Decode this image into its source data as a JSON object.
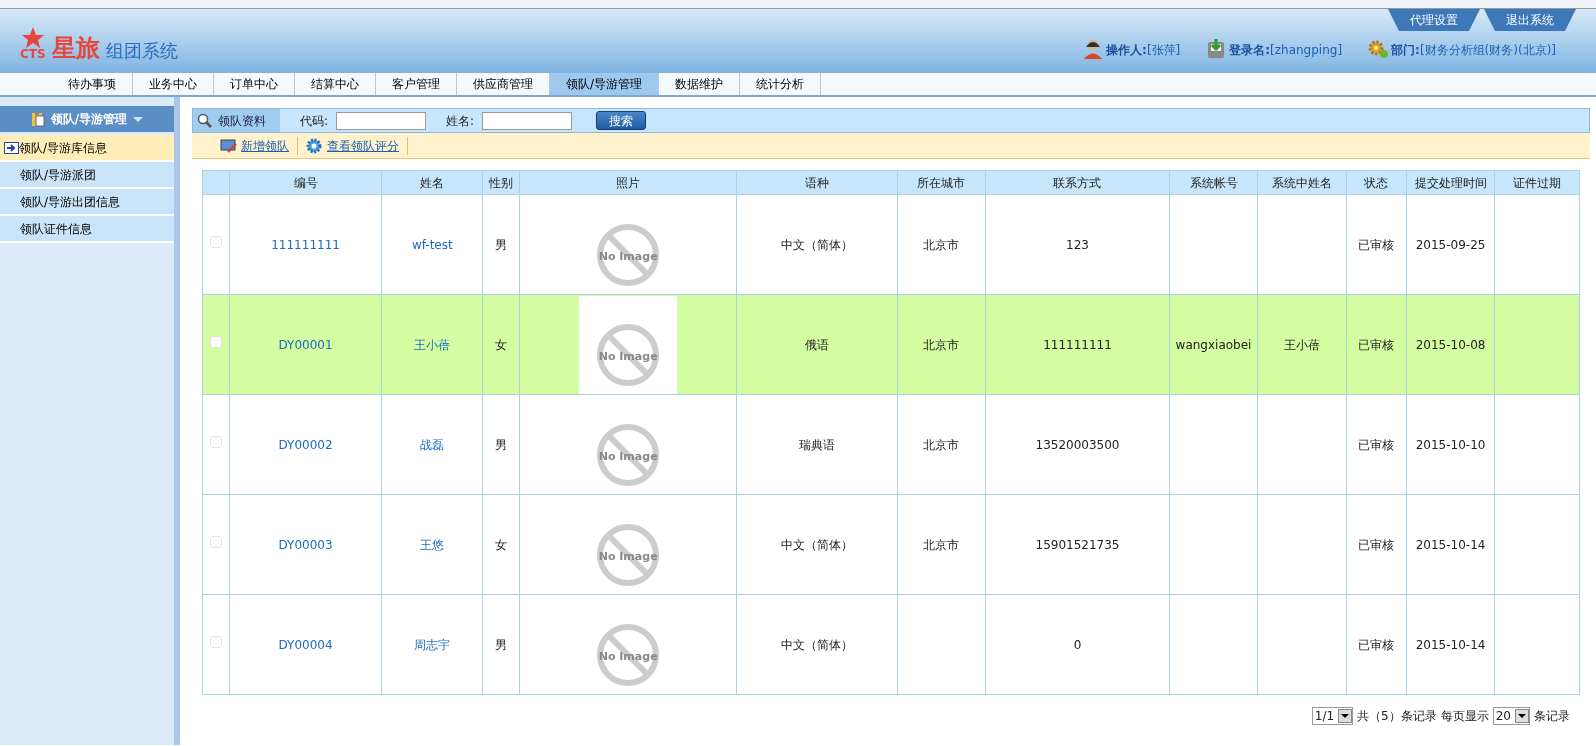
{
  "header": {
    "logo_mark": "CTS",
    "brand": "星旅",
    "system_name": "组团系统",
    "top_buttons": [
      "代理设置",
      "退出系统"
    ],
    "user_info": [
      {
        "kind": "operator",
        "label": "操作人:",
        "value": "[张萍]"
      },
      {
        "kind": "login",
        "label": "登录名:",
        "value": "[zhangping]"
      },
      {
        "kind": "department",
        "label": "部门:",
        "value": "[财务分析组(财务)(北京)]"
      }
    ]
  },
  "nav_tabs": [
    {
      "label": "待办事项",
      "selected": false
    },
    {
      "label": "业务中心",
      "selected": false
    },
    {
      "label": "订单中心",
      "selected": false
    },
    {
      "label": "结算中心",
      "selected": false
    },
    {
      "label": "客户管理",
      "selected": false
    },
    {
      "label": "供应商管理",
      "selected": false
    },
    {
      "label": "领队/导游管理",
      "selected": true
    },
    {
      "label": "数据维护",
      "selected": false
    },
    {
      "label": "统计分析",
      "selected": false
    }
  ],
  "sidebar": {
    "title": "领队/导游管理",
    "items": [
      {
        "label": "领队/导游库信息",
        "selected": true
      },
      {
        "label": "领队/导游派团",
        "selected": false
      },
      {
        "label": "领队/导游出团信息",
        "selected": false
      },
      {
        "label": "领队证件信息",
        "selected": false
      }
    ]
  },
  "search_bar": {
    "tab": "领队资料",
    "fields": [
      {
        "label": "代码:"
      },
      {
        "label": "姓名:"
      }
    ],
    "button": "搜索"
  },
  "toolbar": [
    {
      "kind": "add",
      "label": "新增领队"
    },
    {
      "kind": "rating",
      "label": "查看领队评分"
    }
  ],
  "table": {
    "columns": [
      "编号",
      "姓名",
      "性别",
      "照片",
      "语种",
      "所在城市",
      "联系方式",
      "系统帐号",
      "系统中姓名",
      "状态",
      "提交处理时间",
      "证件过期"
    ],
    "rows": [
      {
        "checked": false,
        "highlighted": false,
        "code": "111111111",
        "name": "wf-test",
        "gender": "男",
        "photo": "No Image",
        "language": "中文（简体）",
        "city": "北京市",
        "contact": "123",
        "status": "已审核",
        "submitted": "2015-09-25"
      },
      {
        "checked": false,
        "highlighted": true,
        "code": "DY00001",
        "name": "王小蓓",
        "gender": "女",
        "photo": "No Image",
        "language": "俄语",
        "city": "北京市",
        "contact": "111111111",
        "account": "wangxiaobei",
        "account_name": "王小蓓",
        "status": "已审核",
        "submitted": "2015-10-08"
      },
      {
        "checked": false,
        "highlighted": false,
        "code": "DY00002",
        "name": "战磊",
        "gender": "男",
        "photo": "No Image",
        "language": "瑞典语",
        "city": "北京市",
        "contact": "13520003500",
        "status": "已审核",
        "submitted": "2015-10-10"
      },
      {
        "checked": false,
        "highlighted": false,
        "code": "DY00003",
        "name": "王悠",
        "gender": "女",
        "photo": "No Image",
        "language": "中文（简体）",
        "city": "北京市",
        "contact": "15901521735",
        "status": "已审核",
        "submitted": "2015-10-14"
      },
      {
        "checked": false,
        "highlighted": false,
        "code": "DY00004",
        "name": "周志宇",
        "gender": "男",
        "photo": "No Image",
        "language": "中文（简体）",
        "contact": "0",
        "status": "已审核",
        "submitted": "2015-10-14"
      }
    ]
  },
  "pagination": {
    "page": "1/1",
    "total_text": "共（5）条记录",
    "per_page_label": "每页显示",
    "per_page": "20",
    "suffix": "条记录"
  }
}
